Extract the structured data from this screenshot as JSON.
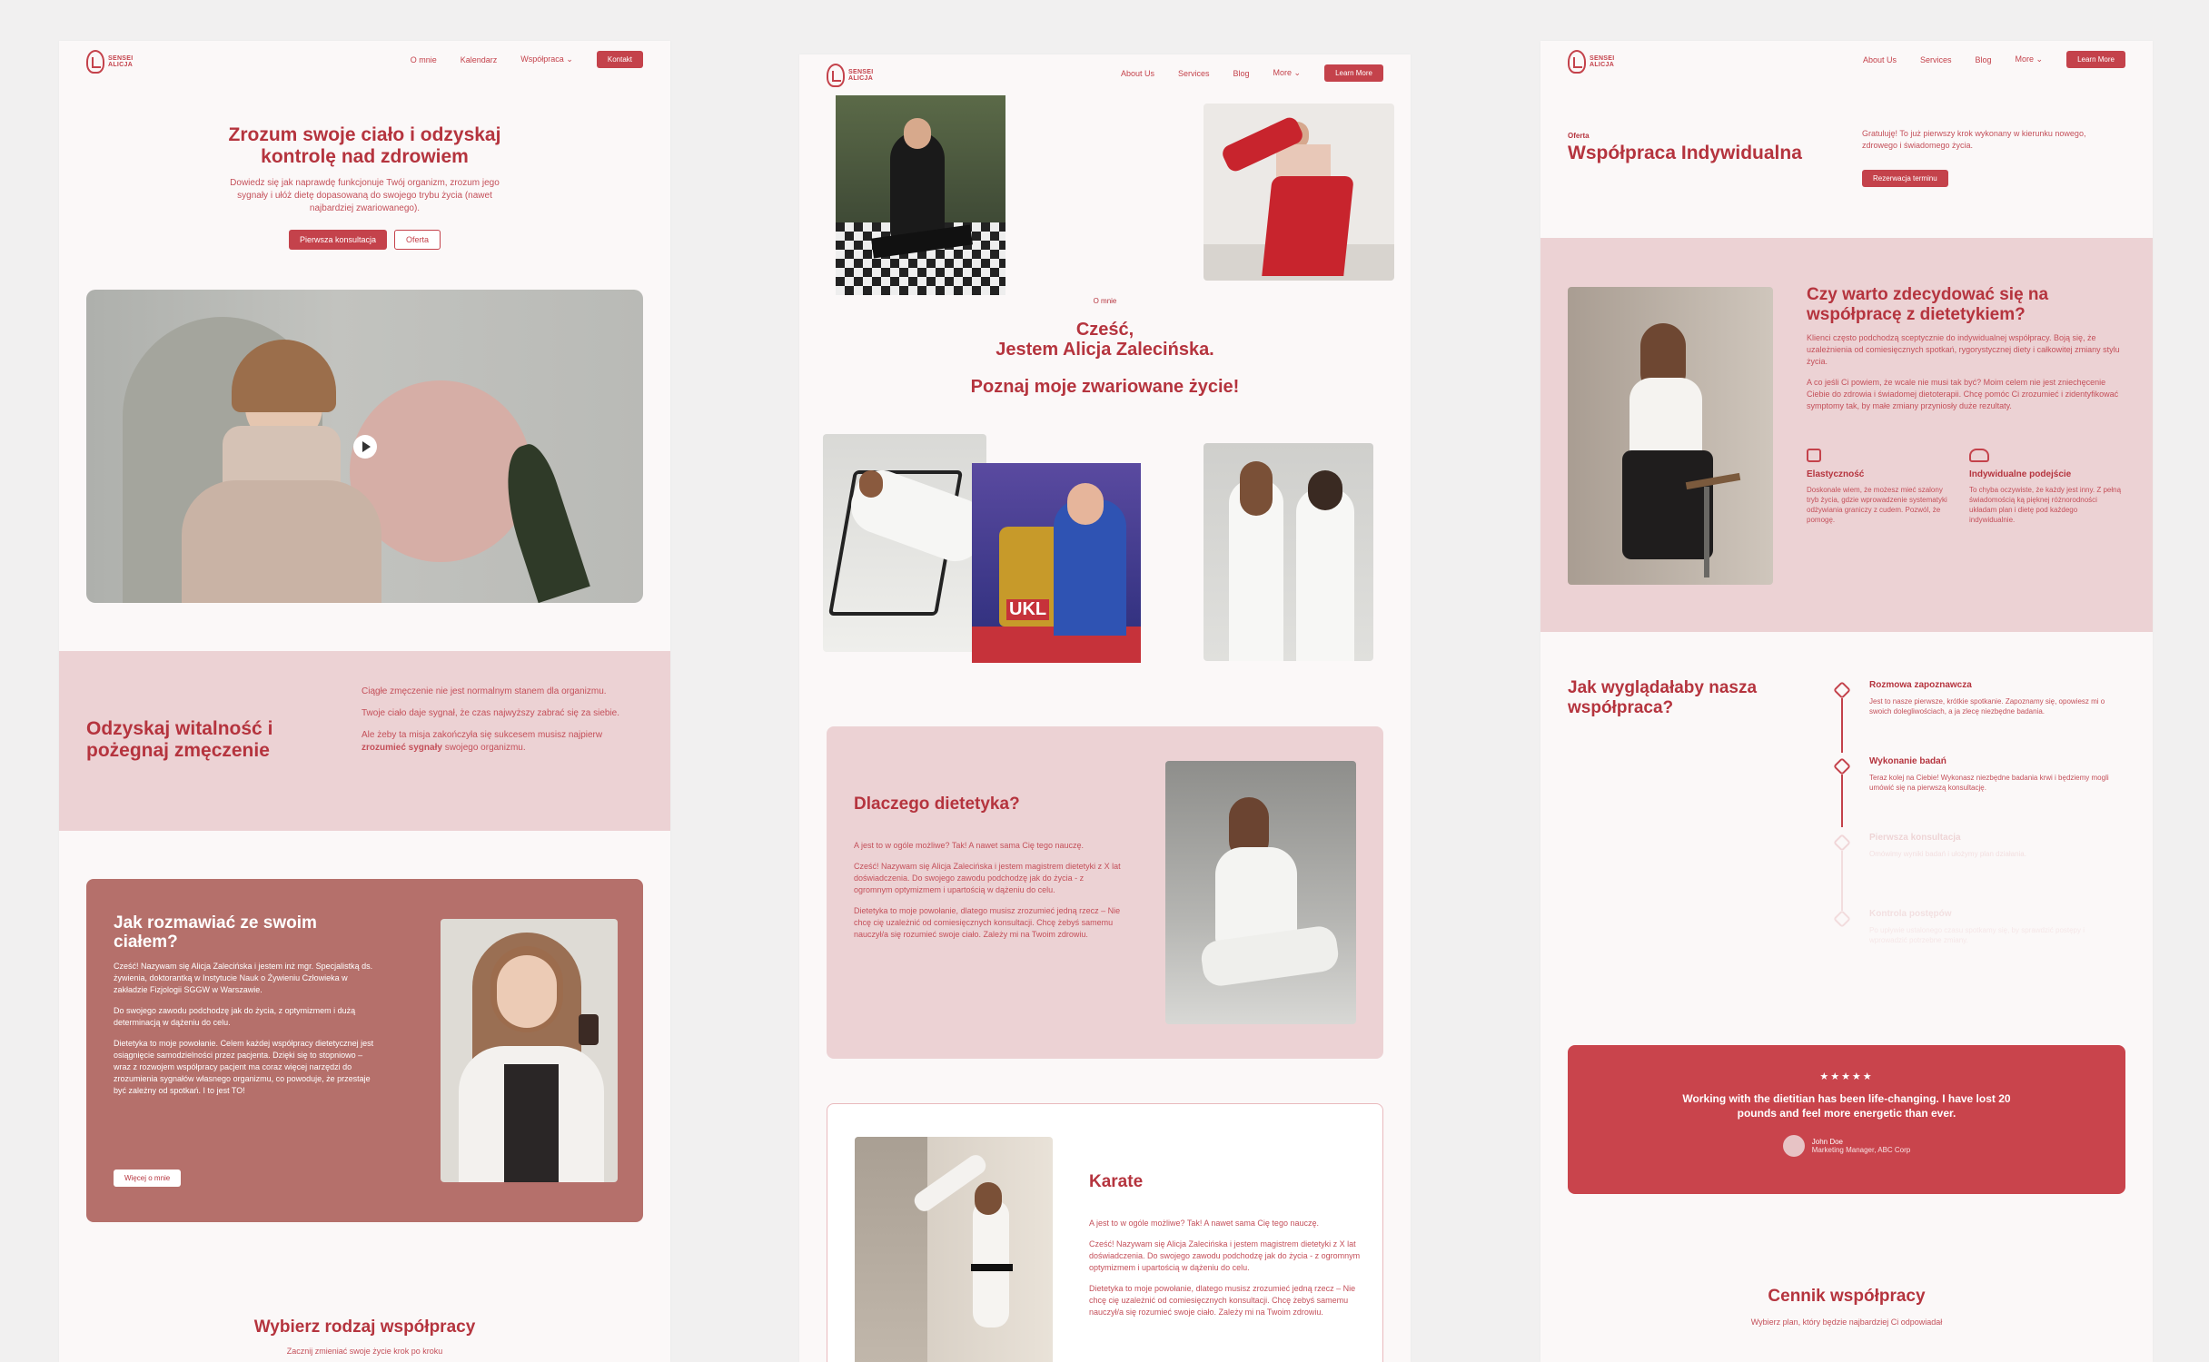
{
  "page1": {
    "logo": "SENSEI ALICJA",
    "nav": [
      "O mnie",
      "Kalendarz",
      "Współpraca ⌄"
    ],
    "nav_button": "Kontakt",
    "hero_title_1": "Zrozum swoje ciało i odzyskaj",
    "hero_title_2": "kontrolę nad zdrowiem",
    "hero_text": "Dowiedz się jak naprawdę funkcjonuje Twój organizm, zrozum jego sygnały i ułóż dietę dopasowaną do swojego trybu życia (nawet najbardziej zwariowanego).",
    "btn_primary": "Pierwsza konsultacja",
    "btn_secondary": "Oferta",
    "band_title": "Odzyskaj witalność i pożegnaj zmęczenie",
    "band_p1": "Ciągłe zmęczenie nie jest normalnym stanem dla organizmu.",
    "band_p2": "Twoje ciało daje sygnał, że czas najwyższy zabrać się za siebie.",
    "band_p3_a": "Ale żeby ta misja zakończyła się sukcesem musisz najpierw",
    "band_p3_b": "zrozumieć sygnały",
    "band_p3_c": "swojego organizmu.",
    "card_title": "Jak rozmawiać ze swoim ciałem?",
    "card_p1": "Cześć! Nazywam się Alicja Zalecińska i jestem inż mgr. Specjalistką ds. żywienia, doktorantką w Instytucie Nauk o Żywieniu Człowieka w zakładzie Fizjologii SGGW w Warszawie.",
    "card_p2": "Do swojego zawodu podchodzę jak do życia, z optymizmem i dużą determinacją w dążeniu do celu.",
    "card_p3": "Dietetyka to moje powołanie. Celem każdej współpracy dietetycznej jest osiągnięcie samodzielności przez pacjenta. Dzięki się to stopniowo – wraz z rozwojem współpracy pacjent ma coraz więcej narzędzi do zrozumienia sygnałów własnego organizmu, co powoduje, że przestaje być zależny od spotkań. I to jest TO!",
    "card_button": "Więcej o mnie",
    "bottom_title": "Wybierz rodzaj współpracy",
    "bottom_sub": "Zacznij zmieniać swoje życie krok po kroku"
  },
  "page2": {
    "nav": [
      "About Us",
      "Services",
      "Blog",
      "More ⌄"
    ],
    "nav_button": "Learn More",
    "eyebrow": "O mnie",
    "title_1": "Cześć,",
    "title_2": "Jestem Alicja Zalecińska.",
    "title_3": "Poznaj moje zwariowane życie!",
    "trophy_label": "UKL",
    "pink_title": "Dlaczego dietetyka?",
    "pink_p1": "A jest to w ogóle możliwe? Tak! A nawet sama Cię tego nauczę.",
    "pink_p2": "Cześć! Nazywam się Alicja Zalecińska i jestem magistrem dietetyki z X lat doświadczenia. Do swojego zawodu podchodzę jak do życia - z ogromnym optymizmem i upartością w dążeniu do celu.",
    "pink_p3": "Dietetyka to moje powołanie, dlatego musisz zrozumieć jedną rzecz – Nie chcę cię uzależnić od comiesięcznych konsultacji. Chcę żebyś samemu nauczył/a się rozumieć swoje ciało. Zależy mi na Twoim zdrowiu.",
    "karate_title": "Karate",
    "karate_p1": "A jest to w ogóle możliwe? Tak! A nawet sama Cię tego nauczę.",
    "karate_p2": "Cześć! Nazywam się Alicja Zalecińska i jestem magistrem dietetyki z X lat doświadczenia. Do swojego zawodu podchodzę jak do życia - z ogromnym optymizmem i upartością w dążeniu do celu.",
    "karate_p3": "Dietetyka to moje powołanie, dlatego musisz zrozumieć jedną rzecz – Nie chcę cię uzależnić od comiesięcznych konsultacji. Chcę żebyś samemu nauczył/a się rozumieć swoje ciało. Zależy mi na Twoim zdrowiu."
  },
  "page3": {
    "nav": [
      "About Us",
      "Services",
      "Blog",
      "More ⌄"
    ],
    "nav_button": "Learn More",
    "eyebrow": "Oferta",
    "title": "Współpraca Indywidualna",
    "intro": "Gratuluję! To już pierwszy krok wykonany w kierunku nowego, zdrowego i świadomego życia.",
    "intro_button": "Rezerwacja terminu",
    "band_title": "Czy warto zdecydować się na współpracę z dietetykiem?",
    "band_p1": "Klienci często podchodzą sceptycznie do indywidualnej współpracy. Boją się, że uzależnienia od comiesięcznych spotkań, rygorystycznej diety i całkowitej zmiany stylu życia.",
    "band_p2": "A co jeśli Ci powiem, że wcale nie musi tak być? Moim celem nie jest zniechęcenie Ciebie do zdrowia i świadomej dietoterapii. Chcę pomóc Ci zrozumieć i zidentyfikować symptomy tak, by małe zmiany przyniosły duże rezultaty.",
    "feat1_title": "Elastyczność",
    "feat1_text": "Doskonale wiem, że możesz mieć szalony tryb życia, gdzie wprowadzenie systematyki odżywiania graniczy z cudem. Pozwól, że pomogę.",
    "feat2_title": "Indywidualne podejście",
    "feat2_text": "To chyba oczywiste, że każdy jest inny. Z pełną świadomością ką pięknej różnorodności układam plan i dietę pod każdego indywidualnie.",
    "process_title": "Jak wyglądałaby nasza współpraca?",
    "steps": [
      {
        "title": "Rozmowa zapoznawcza",
        "text": "Jest to nasze pierwsze, krótkie spotkanie. Zapoznamy się, opowiesz mi o swoich dolegliwościach, a ja zlecę niezbędne badania."
      },
      {
        "title": "Wykonanie badań",
        "text": "Teraz kolej na Ciebie! Wykonasz niezbędne badania krwi i będziemy mogli umówić się na pierwszą konsultację."
      },
      {
        "title": "Pierwsza konsultacja",
        "text": "Omówimy wyniki badań i ułożymy plan działania."
      },
      {
        "title": "Kontrola postępów",
        "text": "Po upływie ustalonego czasu spotkamy się, by sprawdzić postępy i wprowadzić potrzebne zmiany."
      }
    ],
    "stars": "★★★★★",
    "quote": "Working with the dietitian has been life-changing. I have lost 20 pounds and feel more energetic than ever.",
    "author": "John Doe",
    "author_role": "Marketing Manager, ABC Corp",
    "pricing_title": "Cennik współpracy",
    "pricing_sub": "Wybierz plan, który będzie najbardziej Ci odpowiadał"
  },
  "colors": {
    "accent": "#c4424b",
    "pink": "#ecd2d4",
    "brown": "#b5706b",
    "bg": "#fbf8f8"
  }
}
